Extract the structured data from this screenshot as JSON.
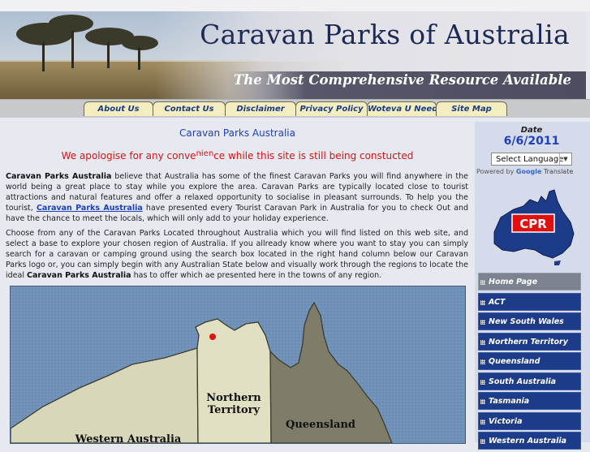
{
  "header": {
    "title": "Caravan Parks of Australia",
    "tagline": "The Most Comprehensive Resource Available"
  },
  "nav": {
    "tabs": [
      {
        "label": "About Us"
      },
      {
        "label": "Contact Us"
      },
      {
        "label": "Disclaimer"
      },
      {
        "label": "Privacy Policy"
      },
      {
        "label": "Woteva U Need"
      },
      {
        "label": "Site Map"
      }
    ]
  },
  "main": {
    "heading": "Caravan Parks Australia",
    "apology_pre": "We apologise for any conve",
    "apology_sup": "nien",
    "apology_post": "ce while this site is still being constucted",
    "p1_bold": "Caravan Parks Australia",
    "p1_text1": " believe that Australia has some of the finest Caravan Parks you will find anywhere in the world being a great place to stay while you explore the area. Caravan Parks are typically located close to tourist attractions and natural features and offer a relaxed opportunity to socialise in pleasant surrounds. To help you the tourist, ",
    "p1_link": "Caravan Parks Australia",
    "p1_text2": " have presented every Tourist Caravan Park in Australia for you to check Out and have the chance to meet the locals, which will only add to your holiday experience.",
    "p2_text": "Choose from any of the Caravan Parks Located throughout Australia which you will find listed on this web site, and select a base to explore your chosen region of Australia. If you allready know where you want to stay you can simply search for a caravan or camping ground using the search box located in the right hand column below our Caravan Parks logo or, you can simply begin with any Australian State below and visually work through the regions to locate the ideal ",
    "p2_bold": "Caravan Parks Australia",
    "p2_text_end": " has to offer which ae presented here in the towns of any region.",
    "map_labels": {
      "nt_line1": "Northern",
      "nt_line2": "Territory",
      "qld": "Queensland",
      "wa": "Western Australia"
    }
  },
  "sidebar": {
    "date_label": "Date",
    "date_value": "6/6/2011",
    "language_select": "Select Language",
    "powered_by": "Powered by",
    "google": "Google",
    "translate": "Translate",
    "logo_text": "CPR",
    "menu": [
      {
        "label": "Home Page"
      },
      {
        "label": "ACT"
      },
      {
        "label": "New South Wales"
      },
      {
        "label": "Northern Territory"
      },
      {
        "label": "Queensland"
      },
      {
        "label": "South Australia"
      },
      {
        "label": "Tasmania"
      },
      {
        "label": "Victoria"
      },
      {
        "label": "Western Australia"
      }
    ]
  },
  "colors": {
    "brand_blue": "#1c3b88",
    "link_blue": "#1f3fbf",
    "alert_red": "#e01010",
    "tab_bg": "#f3edbf",
    "ocean": "#6f91b8"
  }
}
